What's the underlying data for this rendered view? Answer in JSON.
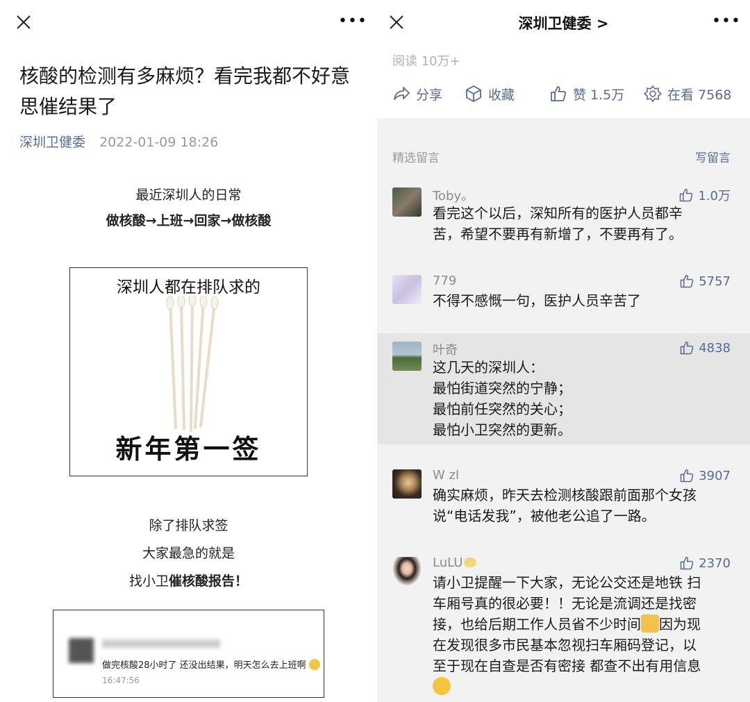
{
  "left": {
    "title": "核酸的检测有多麻烦？看完我都不好意思催结果了",
    "account": "深圳卫健委",
    "date": "2022-01-09 18:26",
    "p1": "最近深圳人的日常",
    "p2": "做核酸→上班→回家→做核酸",
    "image1": {
      "caption_top": "深圳人都在排队求的",
      "caption_bottom": "新年第一签"
    },
    "p3": "除了排队求签",
    "p4": "大家最急的就是",
    "p5_normal": "找小卫",
    "p5_bold": "催核酸报告！",
    "chat": {
      "message": "做完核酸28小时了 还没出结果，明天怎么去上班啊",
      "time": "16:47:56"
    }
  },
  "right": {
    "title": "深圳卫健委 >",
    "reads": "阅读 10万+",
    "actions": {
      "share": "分享",
      "collect": "收藏",
      "like": "赞 1.5万",
      "watching": "在看 7568"
    },
    "selected_label": "精选留言",
    "write_label": "写留言",
    "comments": [
      {
        "name": "Toby。",
        "likes": "1.0万",
        "lines": [
          "看完这个以后，深知所有的医护人员都辛",
          "苦，希望不要再有新增了，不要再有了。"
        ]
      },
      {
        "name": "779",
        "likes": "5757",
        "lines": [
          "不得不感慨一句，医护人员辛苦了"
        ]
      },
      {
        "name": "叶奇",
        "likes": "4838",
        "lines": [
          "这几天的深圳人：",
          "最怕街道突然的宁静；",
          "最怕前任突然的关心；",
          "最怕小卫突然的更新。"
        ]
      },
      {
        "name": "W zl",
        "likes": "3907",
        "lines": [
          "确实麻烦，昨天去检测核酸跟前面那个女孩",
          "说“电话发我”，被他老公追了一路。"
        ]
      },
      {
        "name": "LuLU",
        "likes": "2370",
        "lines": [
          "请小卫提醒一下大家，无论公交还是地铁 扫",
          "车厢号真的很必要！！无论是流调还是找密",
          "接，也给后期工作人员省不少时间",
          "因为现",
          "在发现很多市民基本忽视扫车厢码登记，以",
          "至于现在自查是否有密接 都查不出有用信息"
        ]
      }
    ]
  },
  "colors": {
    "link_blue": "#576b95",
    "meta_gray": "#9a9a9a",
    "comment_bg": "#f2f2f2"
  }
}
